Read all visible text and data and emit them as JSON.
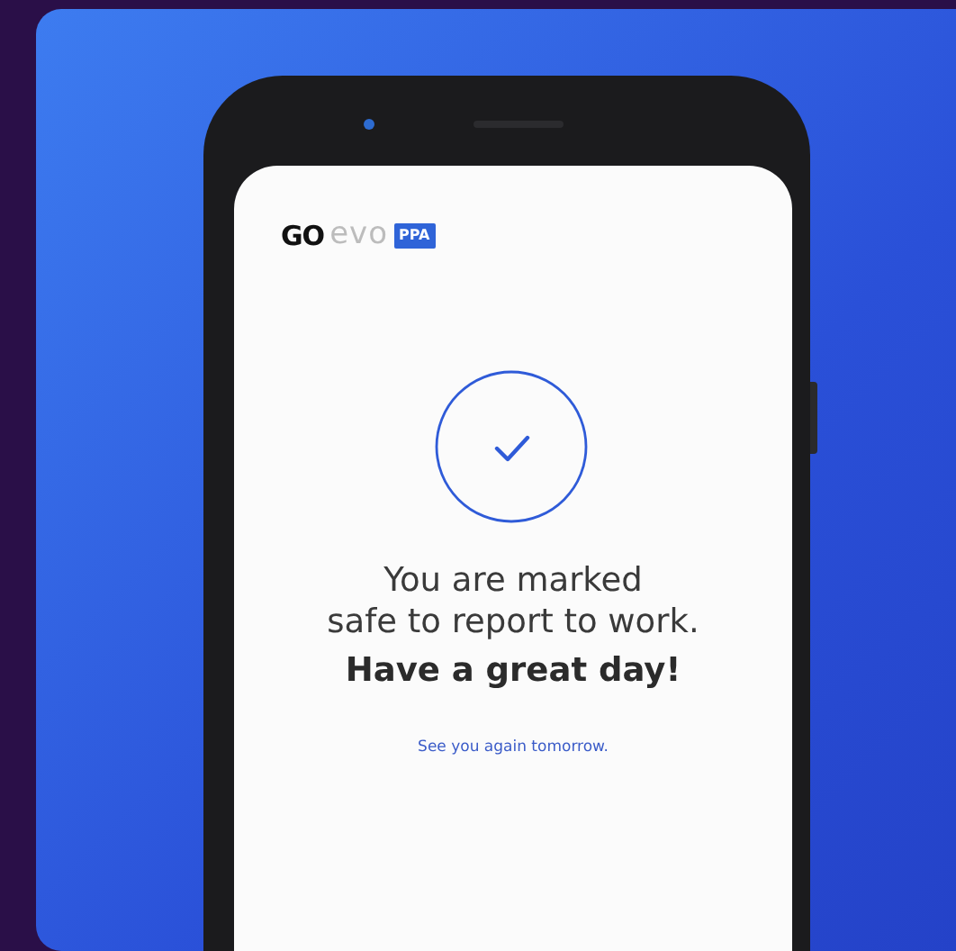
{
  "logo": {
    "brand_dark": "GO",
    "brand_light": "evo",
    "badge": "PPA"
  },
  "status": {
    "checked": true
  },
  "message": {
    "lines": [
      "You are marked",
      "safe to report to work."
    ],
    "emphasis": "Have a great day!"
  },
  "footer_note": "See you again tomorrow."
}
